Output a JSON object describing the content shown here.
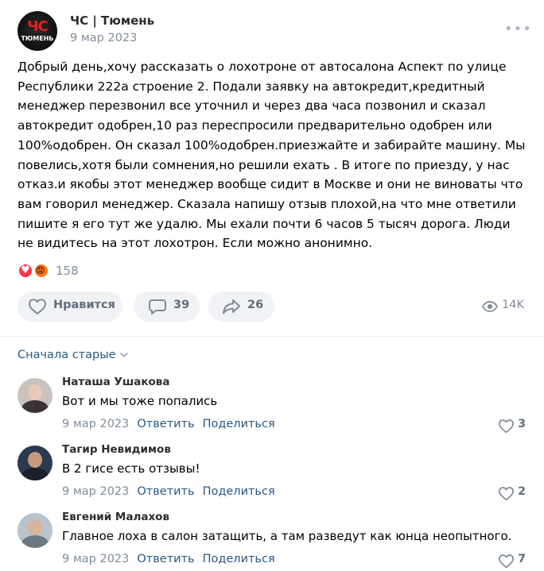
{
  "post": {
    "author": "ЧС | Тюмень",
    "avatar_logo_top": "ЧС",
    "avatar_logo_bottom": "ТЮМЕНЬ",
    "date": "9 мар 2023",
    "more_glyph": "•••",
    "text": "Добрый день,хочу рассказать о лохотроне от автосалона Аспект по улице Республики 222а строение 2. Подали заявку на автокредит,кредитный менеджер перезвонил все уточнил и через два часа позвонил и сказал автокредит одобрен,10 раз переспросили предварительно одобрен или 100%одобрен. Он сказал 100%одобрен.приезжайте и забирайте машину. Мы повелись,хотя были сомнения,но решили ехать . В итоге по приезду, у нас отказ.и якобы этот менеджер вообще сидит в Москве и они не виноваты что вам говорил менеджер. Сказала напишу отзыв плохой,на что мне ответили пишите я его тут же удалю. Мы ехали почти 6 часов 5 тысяч дорога. Люди не видитесь на этот лохотрон. Если можно анонимно.",
    "reactions": {
      "icons": [
        "heart-reaction-icon",
        "angry-reaction-icon"
      ],
      "count": "158"
    },
    "actions": {
      "like_label": "Нравится",
      "comments_count": "39",
      "shares_count": "26"
    },
    "views": "14K"
  },
  "comments_section": {
    "sort_label": "Сначала старые",
    "reply_label": "Ответить",
    "share_label": "Поделиться",
    "items": [
      {
        "name": "Наташа Ушакова",
        "text": "Вот и мы тоже попались",
        "date": "9 мар 2023",
        "likes": "3"
      },
      {
        "name": "Тагир Невидимов",
        "text": "В 2 гисе есть отзывы!",
        "date": "9 мар 2023",
        "likes": "2"
      },
      {
        "name": "Евгений Малахов",
        "text": "Главное лоха в салон затащить, а там разведут как юнца неопытного.",
        "date": "9 мар 2023",
        "likes": "7"
      }
    ]
  },
  "colors": {
    "link": "#2a5885",
    "secondary_text": "#818c99",
    "button_bg": "#f0f2f5",
    "icon": "#818c99",
    "heart_reaction": "#ff3347",
    "angry_reaction": "#ff7a1a"
  }
}
